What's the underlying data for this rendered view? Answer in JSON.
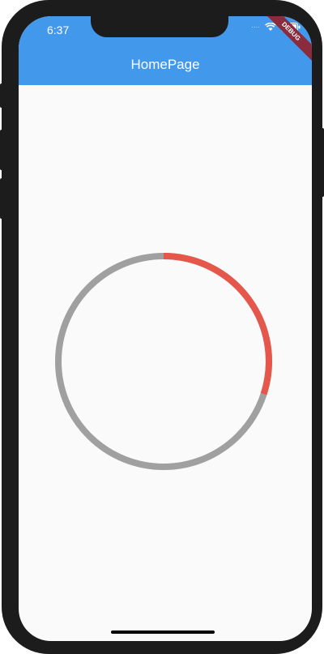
{
  "status_bar": {
    "time": "6:37",
    "signal": "····"
  },
  "debug_banner": {
    "label": "DEBUG"
  },
  "app_bar": {
    "title": "HomePage",
    "color": "#4299ec"
  },
  "progress_ring": {
    "value": 0.3,
    "track_color": "#a0a0a0",
    "progress_color": "#e4574a"
  }
}
